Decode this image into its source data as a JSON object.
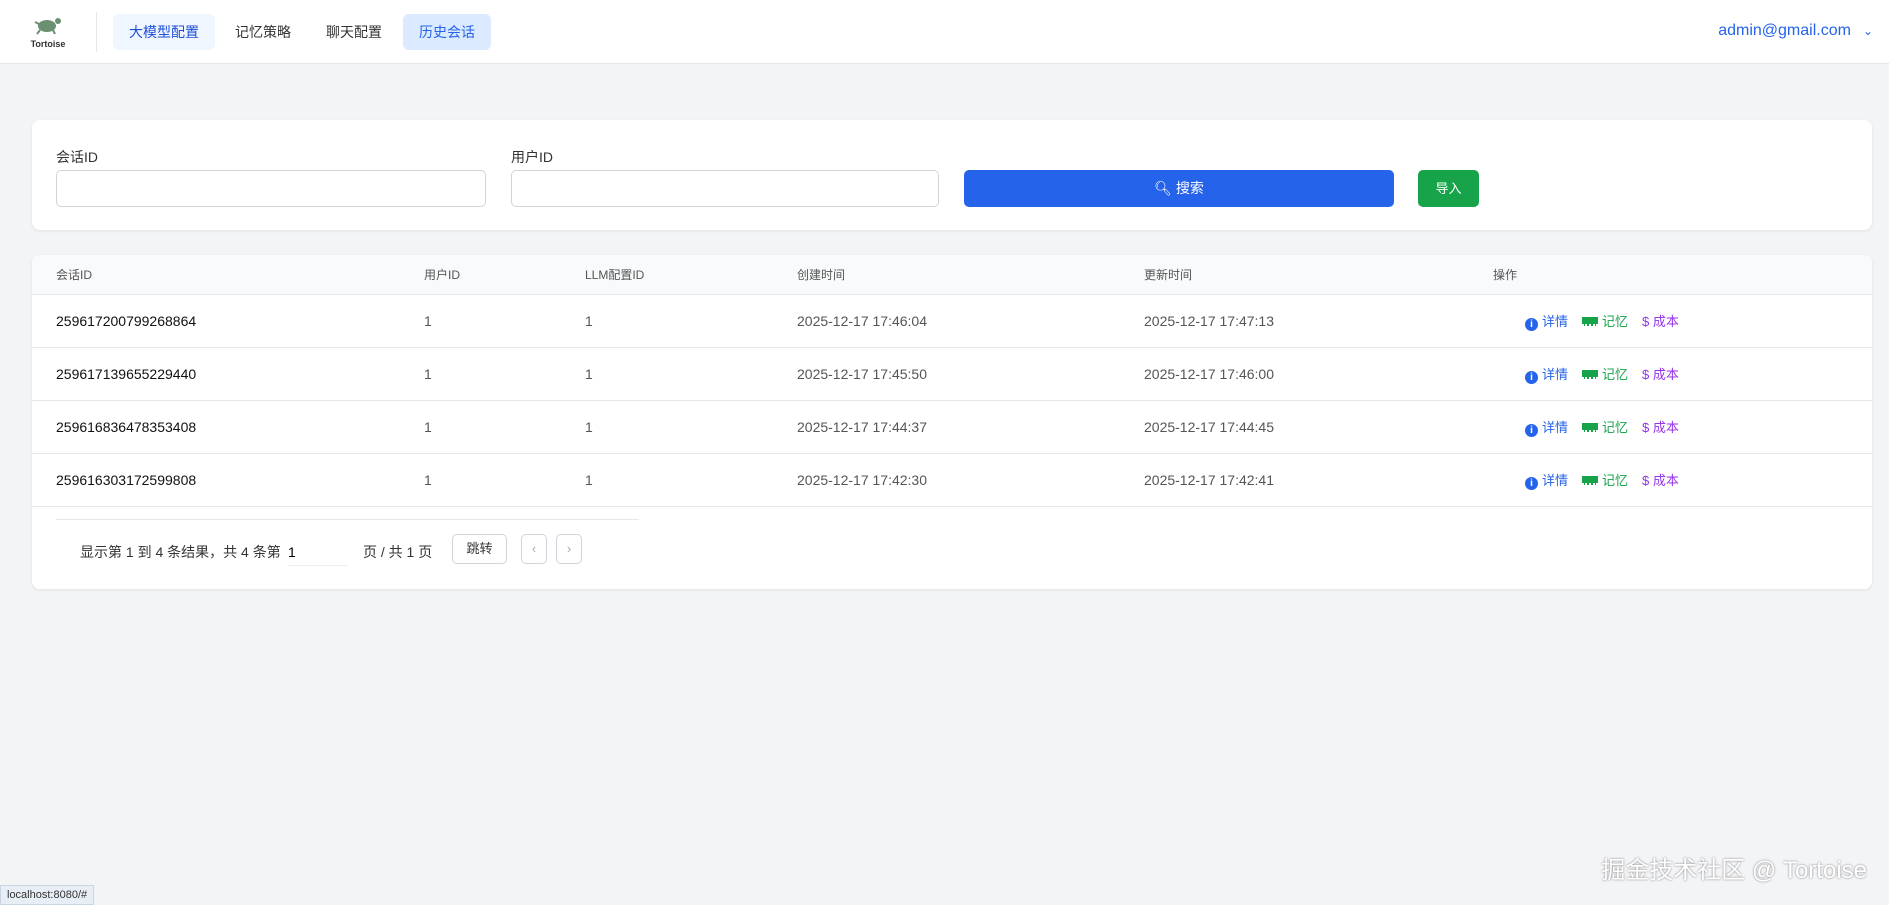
{
  "header": {
    "logo_text": "Tortoise",
    "nav": [
      "大模型配置",
      "记忆策略",
      "聊天配置",
      "历史会话"
    ],
    "user": "admin@gmail.com"
  },
  "search": {
    "session_label": "会话ID",
    "user_label": "用户ID",
    "session_value": "",
    "user_value": "",
    "search_label": "搜索",
    "import_label": "导入"
  },
  "table": {
    "columns": [
      "会话ID",
      "用户ID",
      "LLM配置ID",
      "创建时间",
      "更新时间",
      "操作"
    ],
    "rows": [
      [
        "259617200799268864",
        "1",
        "1",
        "2025-12-17 17:46:04",
        "2025-12-17 17:47:13"
      ],
      [
        "259617139655229440",
        "1",
        "1",
        "2025-12-17 17:45:50",
        "2025-12-17 17:46:00"
      ],
      [
        "259616836478353408",
        "1",
        "1",
        "2025-12-17 17:44:37",
        "2025-12-17 17:44:45"
      ],
      [
        "259616303172599808",
        "1",
        "1",
        "2025-12-17 17:42:30",
        "2025-12-17 17:42:41"
      ]
    ],
    "actions": {
      "detail": "详情",
      "memory": "记忆",
      "cost": "成本"
    }
  },
  "pagination": {
    "summary": "显示第 1 到 4 条结果，共 4 条第",
    "page": "1",
    "total": "页 / 共 1 页",
    "jump": "跳转"
  },
  "watermark": "掘金技术社区 @ Tortoise",
  "status_url": "localhost:8080/#"
}
